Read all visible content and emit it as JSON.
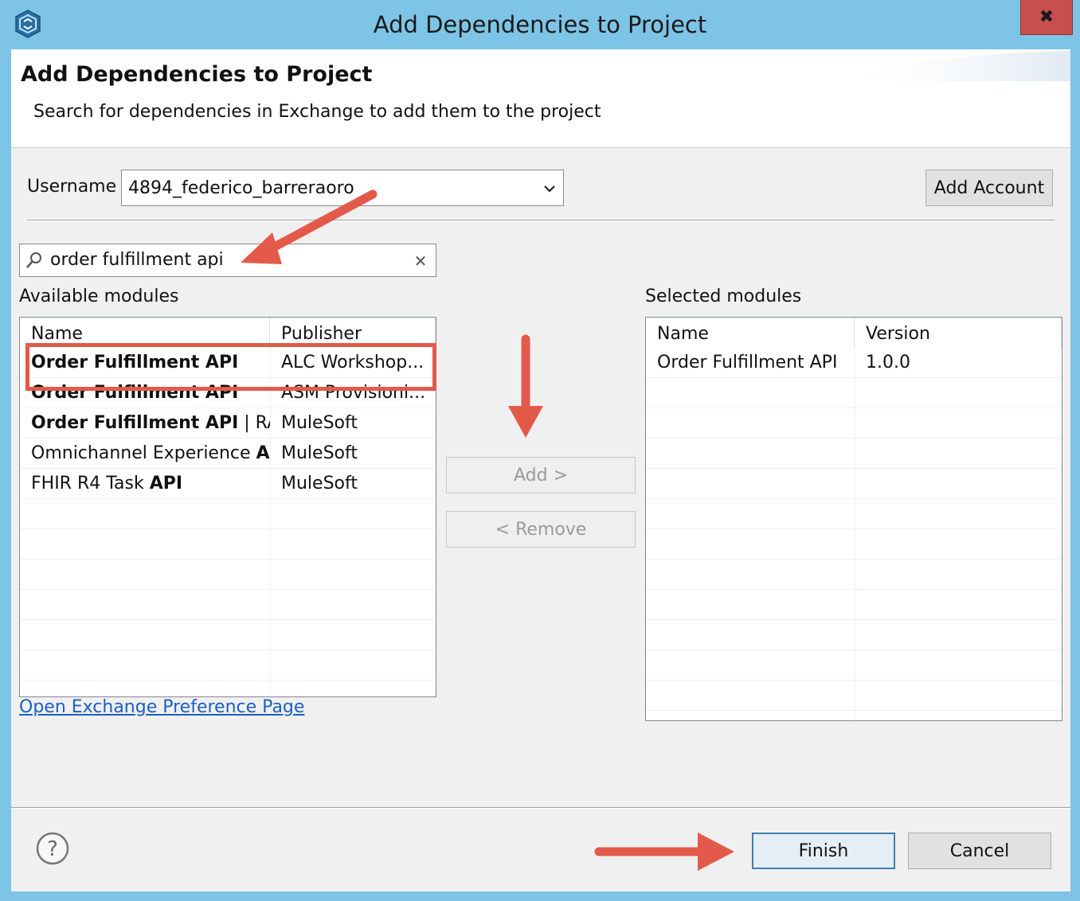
{
  "window": {
    "title": "Add Dependencies to Project",
    "close_glyph": "✖"
  },
  "banner": {
    "title": "Add Dependencies to Project",
    "description": "Search for dependencies in Exchange to add them to the project"
  },
  "account": {
    "username_label": "Username",
    "username_value": "4894_federico_barreraoro",
    "add_account_label": "Add Account"
  },
  "search": {
    "value": "order fulfillment api",
    "clear_glyph": "✕"
  },
  "available": {
    "label": "Available modules",
    "columns": [
      "Name",
      "Publisher"
    ],
    "rows": [
      {
        "name_bold": "Order Fulfillment API",
        "name_rest": "",
        "publisher": "ALC Workshop..."
      },
      {
        "name_bold": "Order Fulfillment API",
        "name_rest": "",
        "publisher": "ASM Provisioni..."
      },
      {
        "name_bold": "Order Fulfillment API",
        "name_rest": " | RAML",
        "publisher": "MuleSoft"
      },
      {
        "name_pre": "Omnichannel Experience ",
        "name_bold": "API",
        "publisher": "MuleSoft"
      },
      {
        "name_pre": "FHIR R4 Task ",
        "name_bold": "API",
        "publisher": "MuleSoft"
      }
    ]
  },
  "actions": {
    "add_label": "Add >",
    "remove_label": "< Remove"
  },
  "selected": {
    "label": "Selected modules",
    "columns": [
      "Name",
      "Version"
    ],
    "rows": [
      {
        "name": "Order Fulfillment API",
        "version": "1.0.0"
      }
    ]
  },
  "footer": {
    "exchange_link": "Open Exchange Preference Page",
    "finish_label": "Finish",
    "cancel_label": "Cancel",
    "help_glyph": "?"
  },
  "colors": {
    "annotation": "#e35a4b",
    "titlebar": "#7dc4e6",
    "close": "#c7504f",
    "link": "#1a5fc4"
  }
}
